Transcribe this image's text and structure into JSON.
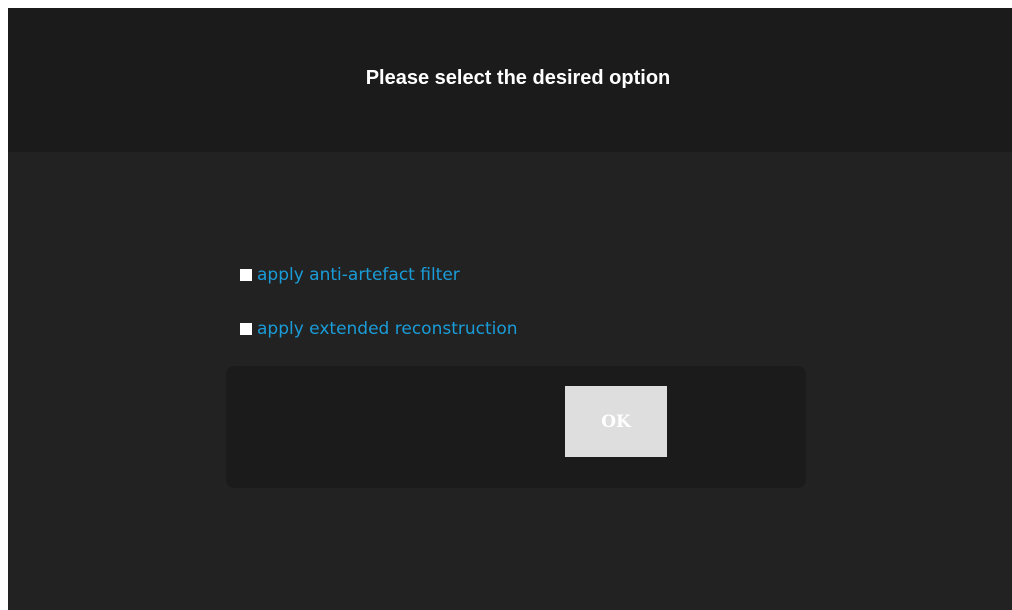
{
  "dialog": {
    "title": "Please select the desired option"
  },
  "options": [
    {
      "label": "apply anti-artefact filter",
      "checked": false
    },
    {
      "label": "apply extended reconstruction",
      "checked": false
    }
  ],
  "actions": {
    "ok_label": "OK"
  },
  "colors": {
    "background": "#222222",
    "header_background": "#1b1b1b",
    "accent": "#1a9cd8",
    "button_background": "#dedede"
  }
}
